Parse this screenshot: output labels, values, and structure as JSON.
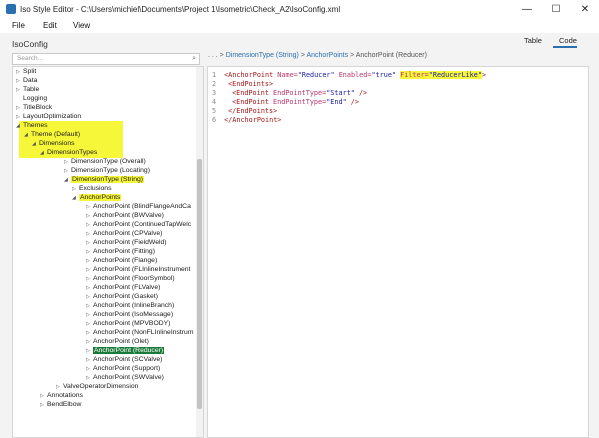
{
  "window": {
    "title": "Iso Style Editor - C:\\Users\\michiel\\Documents\\Project 1\\Isometric\\Check_A2\\IsoConfig.xml",
    "minimize": "—",
    "maximize": "☐",
    "close": "✕"
  },
  "menu": [
    "File",
    "Edit",
    "View"
  ],
  "app_title": "IsoConfig",
  "search": {
    "placeholder": "Search..."
  },
  "tabs": {
    "table": "Table",
    "code": "Code"
  },
  "breadcrumb": {
    "dots": ". . . >",
    "item1": "DimensionType (String)",
    "sep": ">",
    "item2": "AnchorPoints",
    "current": "AnchorPoint (Reducer)"
  },
  "tree": [
    {
      "label": "Split",
      "expanded": false
    },
    {
      "label": "Data",
      "expanded": false
    },
    {
      "label": "Table",
      "expanded": false
    },
    {
      "label": "Logging",
      "expanded": false
    },
    {
      "label": "TitleBlock",
      "expanded": false
    },
    {
      "label": "LayoutOptimization",
      "expanded": false
    },
    {
      "label": "Themes",
      "expanded": true
    },
    {
      "label": "Theme (Default)",
      "expanded": true
    },
    {
      "label": "Dimensions",
      "expanded": true
    },
    {
      "label": "DimensionTypes",
      "expanded": true
    },
    {
      "label": "DimensionType (Overall)",
      "expanded": false
    },
    {
      "label": "DimensionType (Locating)",
      "expanded": false
    },
    {
      "label": "DimensionType (String)",
      "expanded": true
    },
    {
      "label": "Exclusions",
      "expanded": false
    },
    {
      "label": "AnchorPoints",
      "expanded": true
    },
    {
      "label": "AnchorPoint (BlindFlangeAndCa"
    },
    {
      "label": "AnchorPoint (BWValve)"
    },
    {
      "label": "AnchorPoint (ContinuedTapWelc"
    },
    {
      "label": "AnchorPoint (CPValve)"
    },
    {
      "label": "AnchorPoint (FieldWeld)"
    },
    {
      "label": "AnchorPoint (Fitting)"
    },
    {
      "label": "AnchorPoint (Flange)"
    },
    {
      "label": "AnchorPoint (FLInlineInstrument"
    },
    {
      "label": "AnchorPoint (FloorSymbol)"
    },
    {
      "label": "AnchorPoint (FLValve)"
    },
    {
      "label": "AnchorPoint (Gasket)"
    },
    {
      "label": "AnchorPoint (InlineBranch)"
    },
    {
      "label": "AnchorPoint (IsoMessage)"
    },
    {
      "label": "AnchorPoint (MPVBODY)"
    },
    {
      "label": "AnchorPoint (NonFLInlineInstrum"
    },
    {
      "label": "AnchorPoint (Olet)"
    },
    {
      "label": "AnchorPoint (Reducer)",
      "selected": true
    },
    {
      "label": "AnchorPoint (SCValve)"
    },
    {
      "label": "AnchorPoint (Support)"
    },
    {
      "label": "AnchorPoint (SWValve)"
    },
    {
      "label": "ValveOperatorDimension",
      "expanded": false
    },
    {
      "label": "Annotations",
      "expanded": false
    },
    {
      "label": "BendElbow",
      "expanded": false
    }
  ],
  "code": {
    "line_numbers": [
      "1",
      "2",
      "3",
      "4",
      "5",
      "6"
    ],
    "line1": {
      "open": "<AnchorPoint ",
      "name_attr": "Name=",
      "name_val": "\"Reducer\"",
      "enabled_attr": " Enabled=",
      "enabled_val": "\"true\" ",
      "filter_attr": "Filter=",
      "filter_val": "\"ReducerLike\"",
      "close": ">"
    },
    "line2": "<EndPoints>",
    "line3": {
      "open": "<EndPoint ",
      "attr": "EndPointType=",
      "val": "\"Start\"",
      "close": " />"
    },
    "line4": {
      "open": "<EndPoint ",
      "attr": "EndPointType=",
      "val": "\"End\"",
      "close": " />"
    },
    "line5": "</EndPoints>",
    "line6": "</AnchorPoint>"
  }
}
